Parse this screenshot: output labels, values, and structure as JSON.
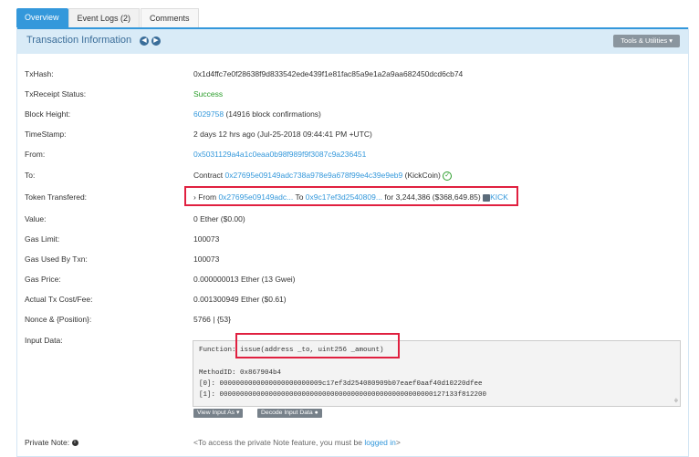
{
  "tabs": [
    "Overview",
    "Event Logs (2)",
    "Comments"
  ],
  "panel": {
    "title": "Transaction Information",
    "tools_label": "Tools & Utilities"
  },
  "rows": {
    "txhash": {
      "label": "TxHash:",
      "value": "0x1d4ffc7e0f28638f9d833542ede439f1e81fac85a9e1a2a9aa682450dcd6cb74"
    },
    "status": {
      "label": "TxReceipt Status:",
      "value": "Success"
    },
    "block": {
      "label": "Block Height:",
      "link": "6029758",
      "extra": "(14916 block confirmations)"
    },
    "timestamp": {
      "label": "TimeStamp:",
      "value": "2 days 12 hrs ago (Jul-25-2018 09:44:41 PM +UTC)"
    },
    "from": {
      "label": "From:",
      "link": "0x5031129a4a1c0eaa0b98f989f9f3087c9a236451"
    },
    "to": {
      "label": "To:",
      "prefix": "Contract",
      "link": "0x27695e09149adc738a978e9a678f99e4c39e9eb9",
      "suffix": "(KickCoin)"
    },
    "token": {
      "label": "Token Transfered:",
      "from_label": "From",
      "from_link": "0x27695e09149adc...",
      "to_label": "To",
      "to_link": "0x9c17ef3d2540809...",
      "for_label": "for",
      "amount": "3,244,386 ($368,649.85)",
      "token_link": "KICK"
    },
    "value": {
      "label": "Value:",
      "value": "0 Ether ($0.00)"
    },
    "gas_limit": {
      "label": "Gas Limit:",
      "value": "100073"
    },
    "gas_used": {
      "label": "Gas Used By Txn:",
      "value": "100073"
    },
    "gas_price": {
      "label": "Gas Price:",
      "value": "0.000000013 Ether (13 Gwei)"
    },
    "fee": {
      "label": "Actual Tx Cost/Fee:",
      "value": "0.001300949 Ether ($0.61)"
    },
    "nonce": {
      "label": "Nonce & {Position}:",
      "value": "5766 | {53}"
    },
    "input": {
      "label": "Input Data:"
    },
    "note": {
      "label": "Private Note:",
      "text_before": "<To access the private Note feature, you must be",
      "link": "logged in",
      "text_after": ">"
    }
  },
  "input_data": {
    "function_label": "Function:",
    "function_sig": "issue(address _to, uint256 _amount)",
    "method_id": "MethodID: 0x867904b4",
    "param0": "[0]:  0000000000000000000000009c17ef3d254080909b07eaef0aaf40d10220dfee",
    "param1": "[1]:  0000000000000000000000000000000000000000000000000000127133f812200",
    "view_btn": "View Input As",
    "decode_btn": "Decode Input Data"
  }
}
